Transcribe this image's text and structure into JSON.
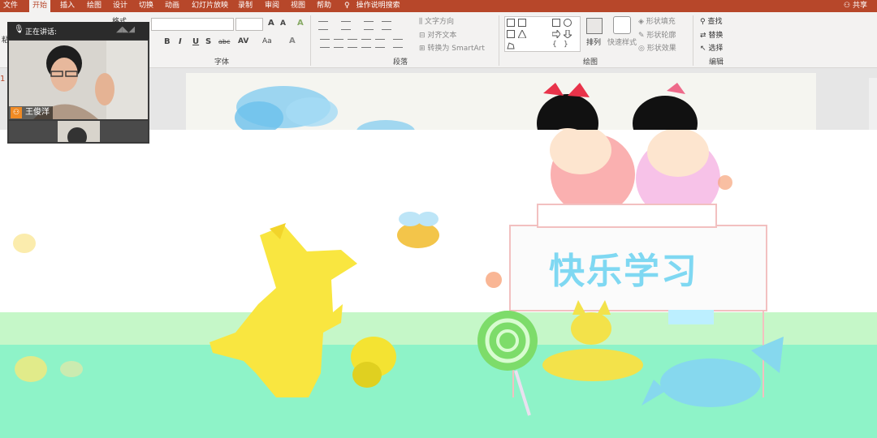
{
  "tabs": [
    "文件",
    "开始",
    "插入",
    "绘图",
    "设计",
    "切换",
    "动画",
    "幻灯片放映",
    "录制",
    "审阅",
    "视图",
    "帮助"
  ],
  "active_tab": "开始",
  "tell_me": "操作说明搜索",
  "share": "共享",
  "ribbon": {
    "paste_label": "粘",
    "format_label": "格式",
    "font_group": "字体",
    "paragraph_group": "段落",
    "drawing_group": "绘图",
    "editing_group": "编辑",
    "text_direction": "文字方向",
    "align_text": "对齐文本",
    "convert_smartart": "转换为 SmartArt",
    "arrange": "排列",
    "quick_styles": "快速样式",
    "shape_fill": "形状填充",
    "shape_outline": "形状轮廓",
    "shape_effects": "形状效果",
    "find": "查找",
    "replace": "替换",
    "select": "选择",
    "bold": "B",
    "italic": "I",
    "underline": "U",
    "strike": "S",
    "shadow": "abc",
    "spacing": "AV",
    "case": "Aa",
    "font_color": "A",
    "grow": "A",
    "shrink": "A",
    "clear": "A"
  },
  "video": {
    "speaking_label": "正在讲话:",
    "participant1": "王俊洋",
    "participant2": "王俊洋"
  },
  "slide": {
    "title": "快乐学习",
    "thumb_number": "1"
  },
  "colors": {
    "title_bar": "#b7472a",
    "ribbon_bg": "#f3f2f1",
    "slide_title": "#7fd8f2"
  }
}
